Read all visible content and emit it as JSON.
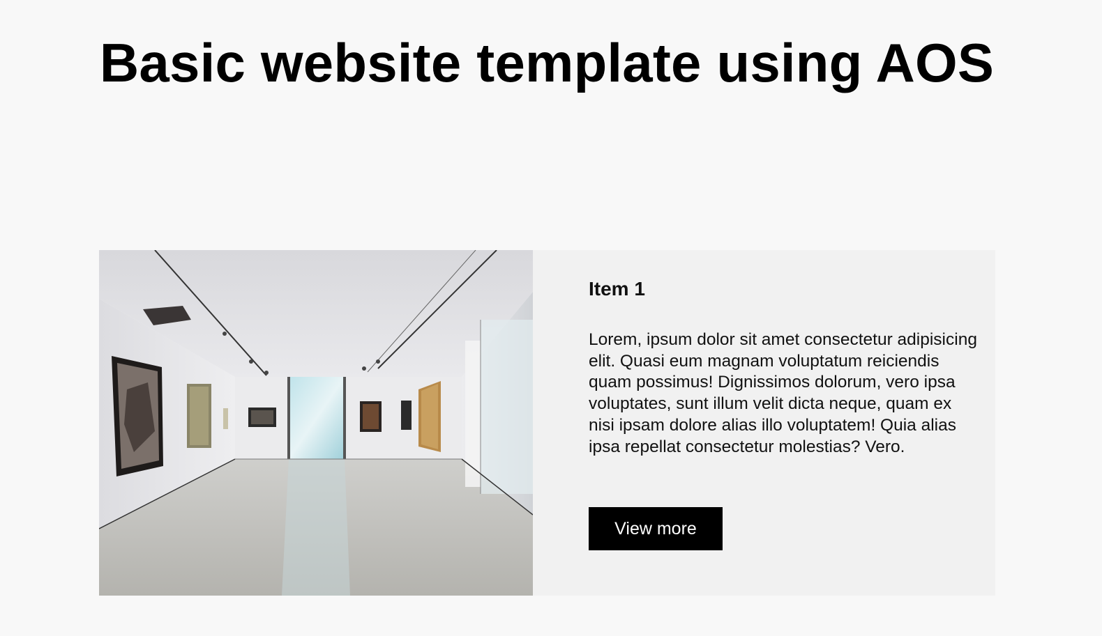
{
  "page": {
    "title": "Basic website template using AOS"
  },
  "item": {
    "heading": "Item 1",
    "text": "Lorem, ipsum dolor sit amet consectetur adipisicing elit. Quasi eum magnam voluptatum reiciendis quam possimus! Dignissimos dolorum, vero ipsa voluptates, sunt illum velit dicta neque, quam ex nisi ipsam dolore alias illo voluptatem! Quia alias ipsa repellat consectetur molestias? Vero.",
    "button_label": "View more"
  },
  "colors": {
    "background": "#f8f8f8",
    "card_background": "#f1f1f1",
    "button_background": "#000000",
    "button_text": "#ffffff"
  }
}
